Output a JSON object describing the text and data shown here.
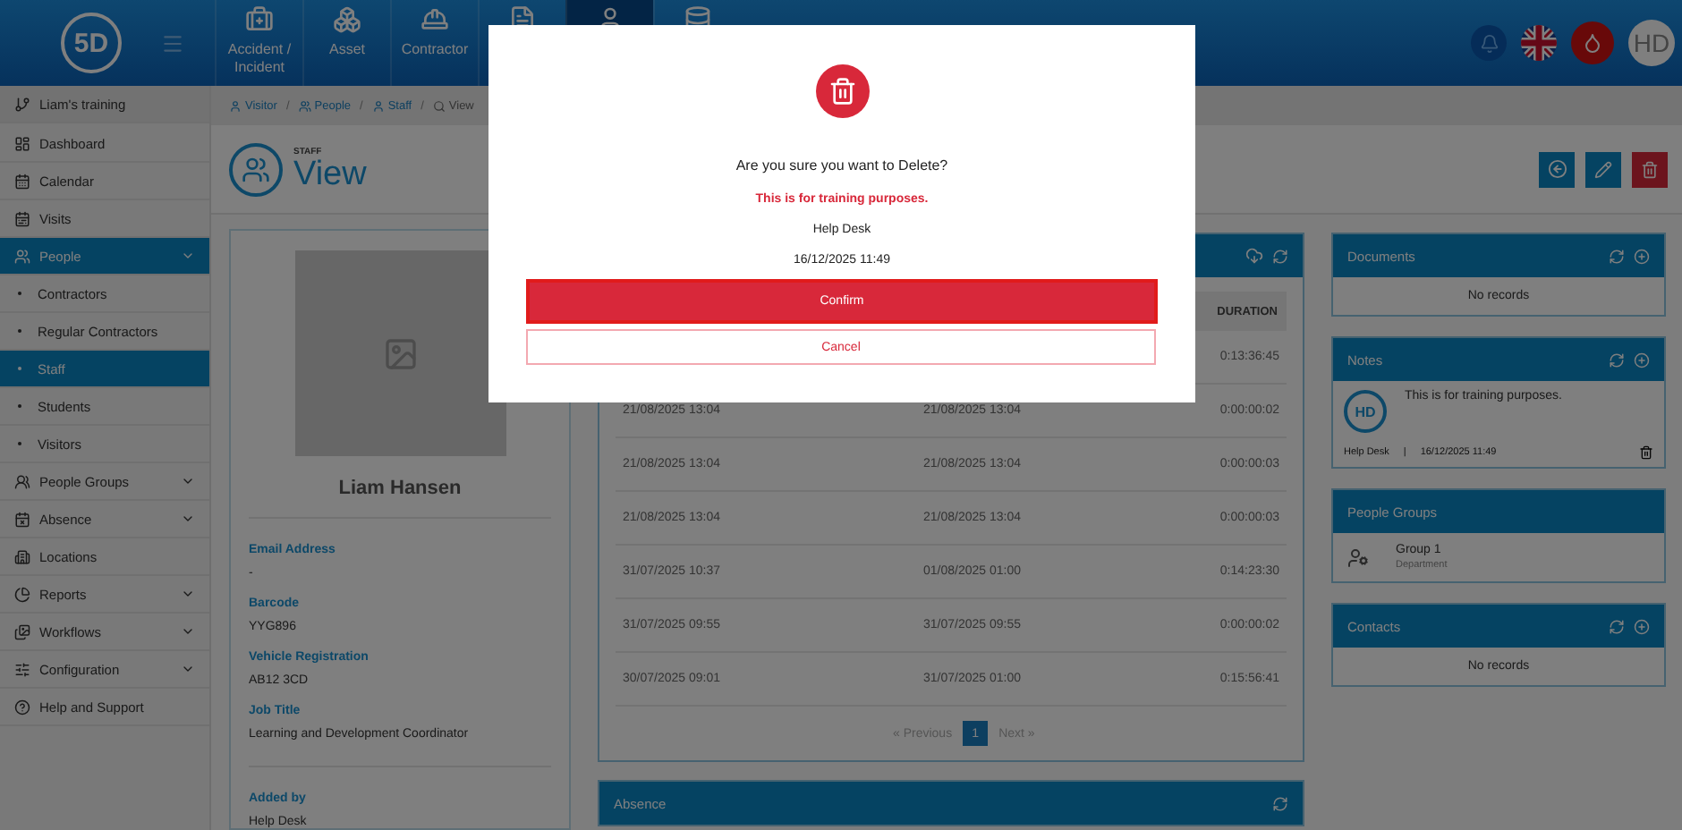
{
  "header": {
    "logo": "5D",
    "nav": [
      {
        "label": "Accident / Incident",
        "selected": false
      },
      {
        "label": "Asset",
        "selected": false
      },
      {
        "label": "Contractor",
        "selected": false
      },
      {
        "selected": false
      },
      {
        "selected": true
      },
      {
        "selected": false
      }
    ],
    "avatar": "HD"
  },
  "sidebar": {
    "site": "Liam's training",
    "items": [
      {
        "kind": "link",
        "label": "Dashboard",
        "selected": false
      },
      {
        "kind": "link",
        "label": "Calendar",
        "selected": false
      },
      {
        "kind": "link",
        "label": "Visits",
        "selected": false
      },
      {
        "kind": "menu",
        "label": "People",
        "selected": true,
        "children": [
          {
            "label": "Contractors",
            "selected": false
          },
          {
            "label": "Regular Contractors",
            "selected": false
          },
          {
            "label": "Staff",
            "selected": true
          },
          {
            "label": "Students",
            "selected": false
          },
          {
            "label": "Visitors",
            "selected": false
          }
        ]
      },
      {
        "kind": "menu",
        "label": "People Groups",
        "selected": false
      },
      {
        "kind": "menu",
        "label": "Absence",
        "selected": false
      },
      {
        "kind": "link",
        "label": "Locations",
        "selected": false
      },
      {
        "kind": "menu",
        "label": "Reports",
        "selected": false
      },
      {
        "kind": "menu",
        "label": "Workflows",
        "selected": false
      },
      {
        "kind": "menu",
        "label": "Configuration",
        "selected": false
      },
      {
        "kind": "link",
        "label": "Help and Support",
        "selected": false
      }
    ]
  },
  "breadcrumb": [
    {
      "label": "Visitor",
      "separator": "/"
    },
    {
      "label": "People",
      "separator": "/"
    },
    {
      "label": "Staff",
      "separator": "/"
    },
    {
      "label": "View"
    }
  ],
  "page": {
    "overline": "STAFF",
    "title": "View"
  },
  "profile": {
    "name": "Liam Hansen",
    "fields": [
      {
        "label": "Email Address",
        "value": "-"
      },
      {
        "label": "Barcode",
        "value": "YYG896"
      },
      {
        "label": "Vehicle Registration",
        "value": "AB12 3CD"
      },
      {
        "label": "Job Title",
        "value": "Learning and Development Coordinator"
      }
    ],
    "added_by": {
      "label": "Added by",
      "value": "Help Desk"
    }
  },
  "history": {
    "columns": [
      "DURATION"
    ],
    "rows": [
      {
        "duration": "0:13:36:45"
      },
      {
        "column_1": "21/08/2025 13:04",
        "column_2": "21/08/2025 13:04",
        "duration": "0:00:00:02"
      },
      {
        "column_1": "21/08/2025 13:04",
        "column_2": "21/08/2025 13:04",
        "duration": "0:00:00:03"
      },
      {
        "column_1": "21/08/2025 13:04",
        "column_2": "21/08/2025 13:04",
        "duration": "0:00:00:03"
      },
      {
        "column_1": "31/07/2025 10:37",
        "column_2": "01/08/2025 01:00",
        "duration": "0:14:23:30"
      },
      {
        "column_1": "31/07/2025 09:55",
        "column_2": "31/07/2025 09:55",
        "duration": "0:00:00:02"
      },
      {
        "column_1": "30/07/2025 09:01",
        "column_2": "31/07/2025 01:00",
        "duration": "0:15:56:41"
      }
    ],
    "pagination": {
      "previous": "« Previous",
      "pages": [
        {
          "label": "1",
          "selected": true
        }
      ],
      "next": "Next »"
    }
  },
  "absence": {
    "title": "Absence"
  },
  "documents": {
    "title": "Documents",
    "empty": "No records"
  },
  "notes": {
    "title": "Notes",
    "items": [
      {
        "avatar": "HD",
        "text": "This is for training purposes.",
        "author": "Help Desk",
        "separator": "|",
        "date": "16/12/2025 11:49"
      }
    ]
  },
  "people_groups": {
    "title": "People Groups",
    "items": [
      {
        "name": "Group 1",
        "type": "Department"
      }
    ]
  },
  "contacts": {
    "title": "Contacts",
    "empty": "No records"
  },
  "dialog": {
    "question": "Are you sure you want to Delete?",
    "note": "This is for training purposes.",
    "author": "Help Desk",
    "date": "16/12/2025 11:49",
    "confirm": "Confirm",
    "cancel": "Cancel"
  }
}
